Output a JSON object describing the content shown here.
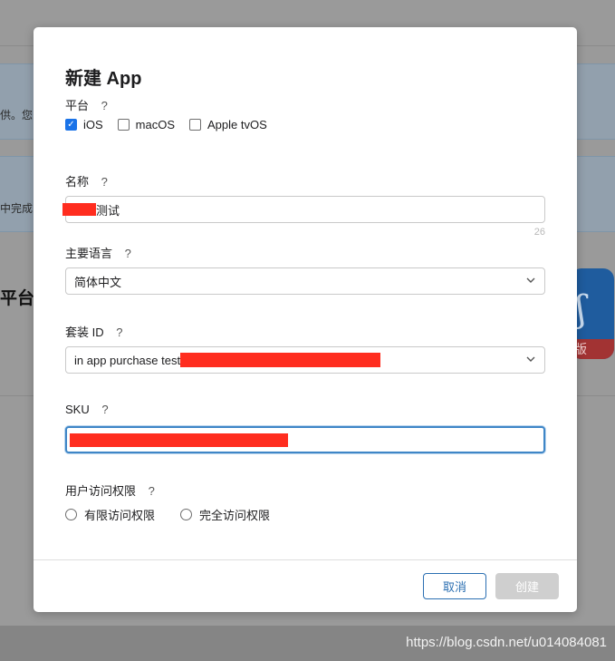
{
  "background": {
    "fragment_1": "供。您",
    "fragment_2": "中完成",
    "heading_fragment": "平台",
    "app_icon_ribbon": "版"
  },
  "modal": {
    "title": "新建 App",
    "help_glyph": "?",
    "platform": {
      "label": "平台",
      "options": [
        {
          "label": "iOS",
          "checked": true
        },
        {
          "label": "macOS",
          "checked": false
        },
        {
          "label": "Apple tvOS",
          "checked": false
        }
      ]
    },
    "name": {
      "label": "名称",
      "value_suffix": "测试",
      "char_count": "26"
    },
    "primary_language": {
      "label": "主要语言",
      "value": "简体中文"
    },
    "bundle_id": {
      "label": "套装 ID",
      "value_prefix": "in app purchase test"
    },
    "sku": {
      "label": "SKU"
    },
    "user_access": {
      "label": "用户访问权限",
      "options": [
        {
          "label": "有限访问权限",
          "selected": false
        },
        {
          "label": "完全访问权限",
          "selected": false
        }
      ]
    },
    "buttons": {
      "cancel": "取消",
      "create": "创建"
    }
  },
  "watermark": "https://blog.csdn.net/u014084081",
  "colors": {
    "primary": "#2b6fb2",
    "checkbox_checked": "#1a73e8",
    "redaction": "#ff2d1f",
    "disabled_button": "#cfcfcf"
  }
}
